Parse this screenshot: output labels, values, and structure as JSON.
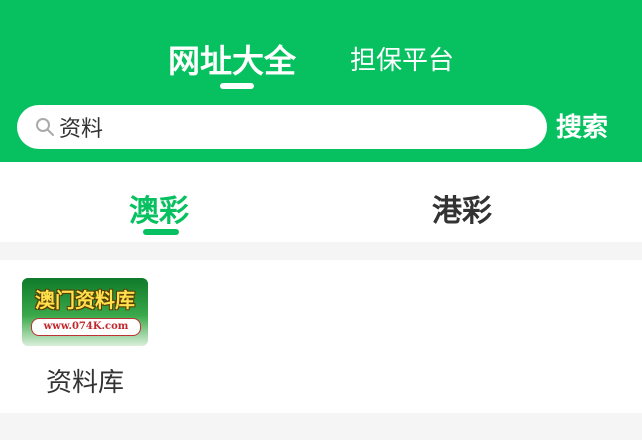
{
  "header": {
    "tabs": [
      {
        "label": "网址大全",
        "active": true
      },
      {
        "label": "担保平台",
        "active": false
      }
    ],
    "background_color": "#07c160"
  },
  "search": {
    "value": "资料",
    "placeholder": "",
    "button_label": "搜索",
    "icon": "search-icon"
  },
  "categories": {
    "tabs": [
      {
        "label": "澳彩",
        "active": true
      },
      {
        "label": "港彩",
        "active": false
      }
    ],
    "accent_color": "#07c160"
  },
  "items": [
    {
      "label": "资料库",
      "thumbnail": {
        "title": "澳门资料库",
        "url": "www.074K.com"
      }
    }
  ]
}
